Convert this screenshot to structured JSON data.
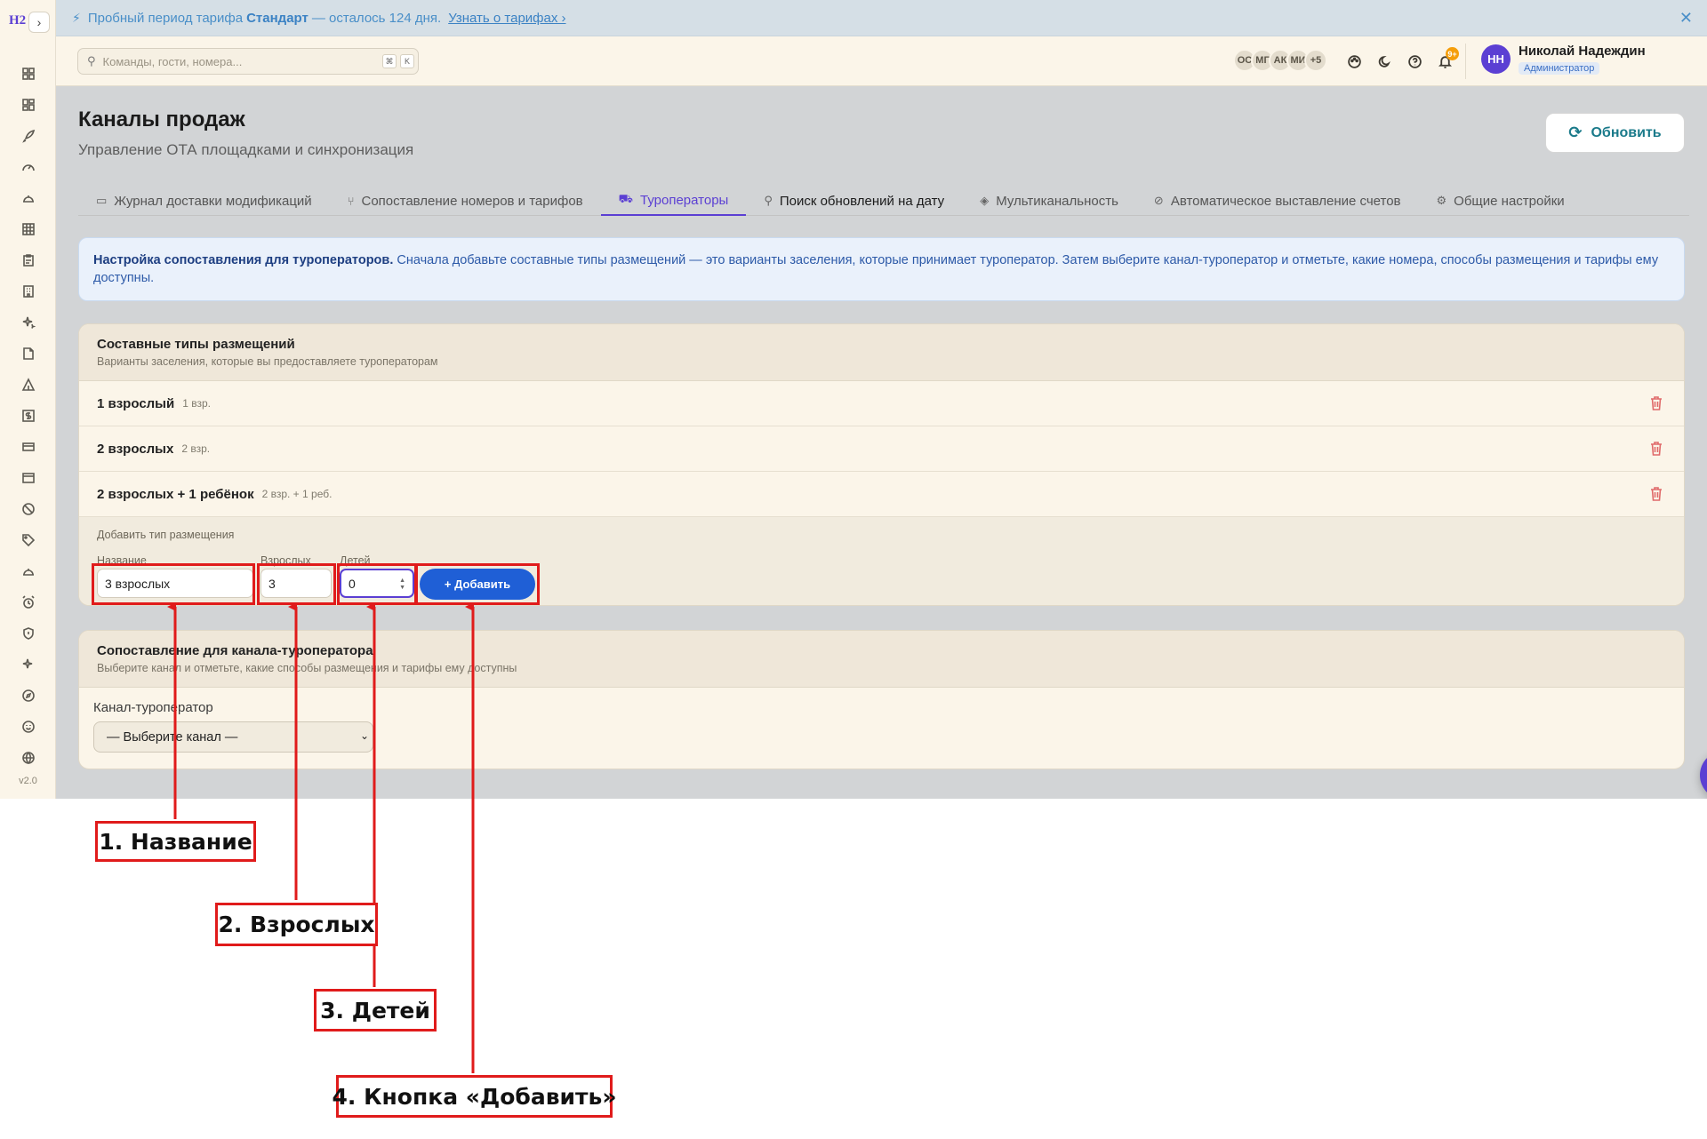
{
  "app": {
    "logo": "H2",
    "version": "v2.0"
  },
  "banner": {
    "prefix": "Пробный период тарифа",
    "plan": "Стандарт",
    "suffix": "— осталось 124 дня.",
    "link": "Узнать о тарифах ›"
  },
  "header": {
    "search_placeholder": "Команды, гости, номера...",
    "kbd1": "⌘",
    "kbd2": "K",
    "avatars": [
      "ОС",
      "МГ",
      "АК",
      "МИ",
      "+5"
    ],
    "notif_badge": "9+",
    "user_initials": "НН",
    "user_name": "Николай Надеждин",
    "user_role": "Администратор"
  },
  "page": {
    "title": "Каналы продаж",
    "subtitle": "Управление ОТА площадками и синхронизация",
    "refresh": "Обновить",
    "tabs": [
      {
        "label": "Журнал доставки модификаций"
      },
      {
        "label": "Сопоставление номеров и тарифов"
      },
      {
        "label": "Туроператоры"
      },
      {
        "label": "Поиск обновлений на дату"
      },
      {
        "label": "Мультиканальность"
      },
      {
        "label": "Автоматическое выставление счетов"
      },
      {
        "label": "Общие настройки"
      }
    ],
    "info_bold": "Настройка сопоставления для туроператоров.",
    "info_text": "Сначала добавьте составные типы размещений — это варианты заселения, которые принимает туроператор. Затем выберите канал-туроператор и отметьте, какие номера, способы размещения и тарифы ему доступны."
  },
  "placements": {
    "title": "Составные типы размещений",
    "subtitle": "Варианты заселения, которые вы предоставляете туроператорам",
    "rows": [
      {
        "name": "1 взрослый",
        "meta": "1 взр."
      },
      {
        "name": "2 взрослых",
        "meta": "2 взр."
      },
      {
        "name": "2 взрослых + 1 ребёнок",
        "meta": "2 взр. + 1 реб."
      }
    ],
    "add": {
      "label": "Добавить тип размещения",
      "name_label": "Название",
      "name_value": "3 взрослых",
      "adults_label": "Взрослых",
      "adults_value": "3",
      "children_label": "Детей",
      "children_value": "0",
      "button": "+ Добавить"
    }
  },
  "mapping": {
    "title": "Сопоставление для канала-туроператора",
    "subtitle": "Выберите канал и отметьте, какие способы размещения и тарифы ему доступны",
    "channel_label": "Канал-туроператор",
    "channel_value": "— Выберите канал —"
  },
  "callouts": [
    "1. Название",
    "2. Взрослых",
    "3. Детей",
    "4. Кнопка «Добавить»"
  ],
  "colors": {
    "accent": "#5b3fd3",
    "annotation": "#e01b1b",
    "add_button": "#1f5fd6"
  }
}
